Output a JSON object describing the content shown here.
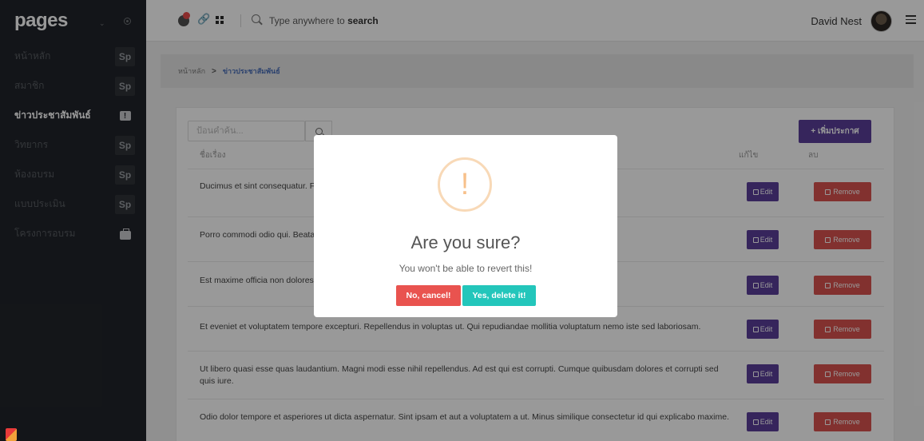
{
  "sidebar": {
    "brand": "pages",
    "items": [
      {
        "label": "หน้าหลัก",
        "badge": "Sp",
        "active": false
      },
      {
        "label": "สมาชิก",
        "badge": "Sp",
        "active": false
      },
      {
        "label": "ข่าวประชาสัมพันธ์",
        "badge": "",
        "icon": "chat-alert-icon",
        "active": true
      },
      {
        "label": "วิทยากร",
        "badge": "Sp",
        "active": false
      },
      {
        "label": "ห้องอบรม",
        "badge": "Sp",
        "active": false
      },
      {
        "label": "แบบประเมิน",
        "badge": "Sp",
        "active": false
      },
      {
        "label": "โครงการอบรม",
        "badge": "",
        "icon": "briefcase-icon",
        "active": false
      }
    ]
  },
  "header": {
    "search_prefix": "Type anywhere to ",
    "search_bold": "search",
    "user_name": "David Nest"
  },
  "breadcrumb": {
    "home": "หน้าหลัก",
    "separator": ">",
    "current": "ข่าวประชาสัมพันธ์"
  },
  "table": {
    "search_placeholder": "ป้อนคำค้น...",
    "add_button": "+ เพิ่มประกาศ",
    "col_title": "ชื่อเรื่อง",
    "col_edit": "แก้ไข",
    "col_delete": "ลบ",
    "edit_label": "Edit",
    "remove_label": "Remove",
    "rows": [
      {
        "text": "Ducimus et sint consequatur. F                                                                                                                              molestiae consequatur voluptas nemo."
      },
      {
        "text": "Porro commodi odio qui. Beata"
      },
      {
        "text": "Est maxime officia non dolores                                                                                                                              t odit."
      },
      {
        "text": "Et eveniet et voluptatem tempore excepturi. Repellendus in voluptas ut. Qui repudiandae mollitia voluptatum nemo iste sed laboriosam."
      },
      {
        "text": "Ut libero quasi esse quas laudantium. Magni modi esse nihil repellendus. Ad est qui est corrupti. Cumque quibusdam dolores et corrupti sed quis iure."
      },
      {
        "text": "Odio dolor tempore et asperiores ut dicta aspernatur. Sint ipsam et aut a voluptatem a ut. Minus similique consectetur id qui explicabo maxime."
      }
    ]
  },
  "modal": {
    "icon": "!",
    "title": "Are you sure?",
    "text": "You won't be able to revert this!",
    "cancel": "No, cancel!",
    "confirm": "Yes, delete it!"
  },
  "colors": {
    "sidebar_bg": "#21242a",
    "primary": "#5a3e99",
    "danger": "#d9534f",
    "confirm": "#23c6bb",
    "warning": "#f7c08a"
  }
}
